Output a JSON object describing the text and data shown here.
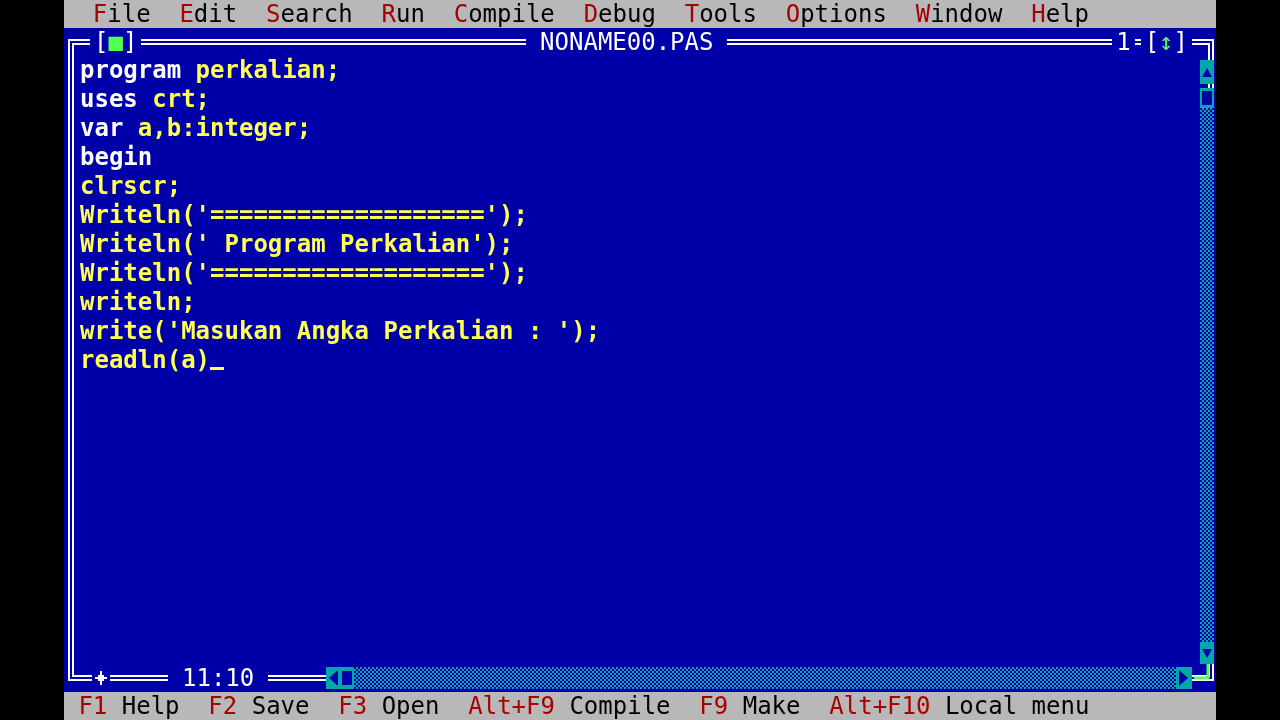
{
  "menu_bar": {
    "items": [
      "File",
      "Edit",
      "Search",
      "Run",
      "Compile",
      "Debug",
      "Tools",
      "Options",
      "Window",
      "Help"
    ]
  },
  "editor": {
    "close_box": "[■]",
    "title": "NONAME00.PAS",
    "window_number": "1",
    "zoom_box": "[↕]",
    "modified": true,
    "cursor_position": "11:10",
    "lines": [
      {
        "segments": [
          {
            "kind": "keyword",
            "text": "program"
          },
          {
            "kind": "plain",
            "text": " perkalian;"
          }
        ]
      },
      {
        "segments": [
          {
            "kind": "keyword",
            "text": "uses"
          },
          {
            "kind": "plain",
            "text": " crt;"
          }
        ]
      },
      {
        "segments": [
          {
            "kind": "keyword",
            "text": "var"
          },
          {
            "kind": "plain",
            "text": " a,b:integer;"
          }
        ]
      },
      {
        "segments": [
          {
            "kind": "keyword",
            "text": "begin"
          }
        ]
      },
      {
        "segments": [
          {
            "kind": "plain",
            "text": "clrscr;"
          }
        ]
      },
      {
        "segments": [
          {
            "kind": "plain",
            "text": "Writeln('===================');"
          }
        ]
      },
      {
        "segments": [
          {
            "kind": "plain",
            "text": "Writeln(' Program Perkalian');"
          }
        ]
      },
      {
        "segments": [
          {
            "kind": "plain",
            "text": "Writeln('===================');"
          }
        ]
      },
      {
        "segments": [
          {
            "kind": "plain",
            "text": "writeln;"
          }
        ]
      },
      {
        "segments": [
          {
            "kind": "plain",
            "text": "write('Masukan Angka Perkalian : ');"
          }
        ]
      },
      {
        "segments": [
          {
            "kind": "plain",
            "text": "readln(a)"
          }
        ]
      }
    ]
  },
  "status_bar": {
    "items": [
      {
        "key": "F1",
        "label": "Help"
      },
      {
        "key": "F2",
        "label": "Save"
      },
      {
        "key": "F3",
        "label": "Open"
      },
      {
        "key": "Alt+F9",
        "label": "Compile"
      },
      {
        "key": "F9",
        "label": "Make"
      },
      {
        "key": "Alt+F10",
        "label": "Local menu"
      }
    ]
  }
}
